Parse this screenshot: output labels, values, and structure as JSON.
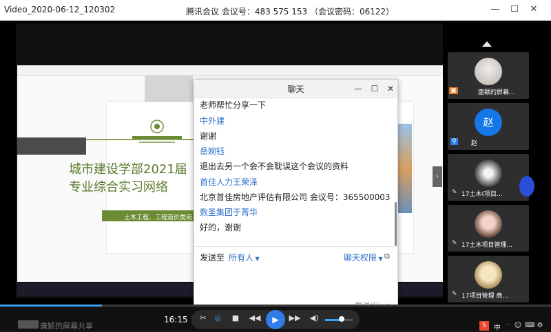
{
  "player": {
    "title": "Video_2020-06-12_120302",
    "meeting_info": "腾讯会议 会议号：483 575 153 （会议密码：06122）",
    "minimize": "—",
    "maximize": "☐",
    "close": "✕"
  },
  "slide": {
    "title_line1": "城市建设学部2021届",
    "title_line2": "专业综合实习网络",
    "green_bar": "土木工程、工程造价类岗"
  },
  "chat": {
    "title": "聊天",
    "minimize": "—",
    "maximize": "☐",
    "close": "✕",
    "messages": [
      {
        "sender": "",
        "text": "老师帮忙分享一下"
      },
      {
        "sender": "中外建",
        "text": "谢谢"
      },
      {
        "sender": "岳婉钰",
        "text": "退出去另一个会不会耽误这个会议的资料"
      },
      {
        "sender": "首佳人力王荣泽",
        "text": "北京首佳房地产评估有限公司 会议号：365500003"
      },
      {
        "sender": "数圣集团于菁华",
        "text": "好的，谢谢"
      }
    ],
    "send_to_label": "发送至",
    "send_to_value": "所有人",
    "permission": "聊天权限",
    "send_button": "发送(S)"
  },
  "participants": [
    {
      "name": "唐颖的屏幕..."
    },
    {
      "name": "赵",
      "avatar_text": "赵"
    },
    {
      "name": "17土木(项目..."
    },
    {
      "name": "17土木项目管理..."
    },
    {
      "name": "17项目管理 商..."
    }
  ],
  "controls": {
    "time": "16:15",
    "progress_fraction": 0.185,
    "volume_fraction": 0.6
  },
  "bottom": {
    "speaker_caption": "唐颖的屏幕共享"
  },
  "colors": {
    "accent": "#2f7ee8",
    "chat_sender": "#2d72c9",
    "slide_green": "#6b8b34"
  }
}
